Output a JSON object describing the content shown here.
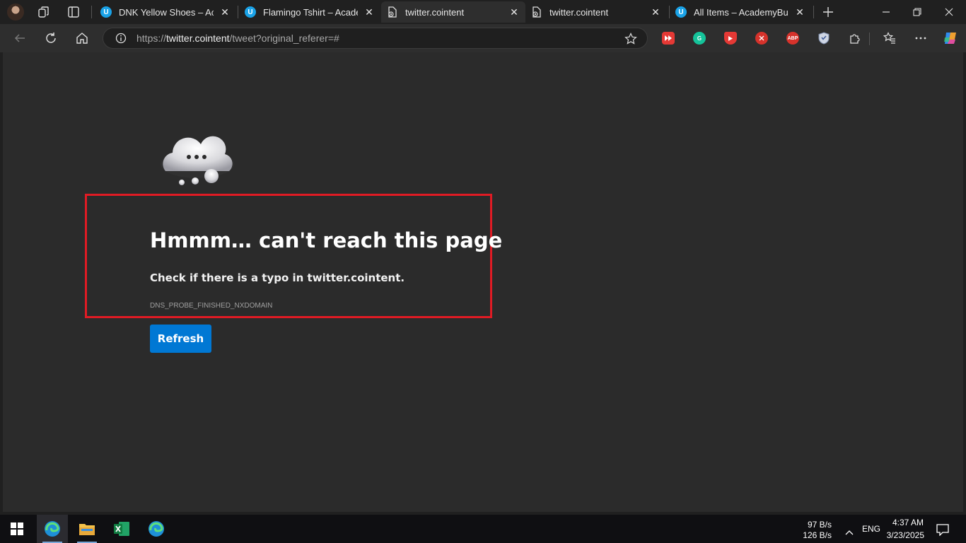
{
  "tabs": [
    {
      "title": "DNK Yellow Shoes – Academ",
      "favicon": "U",
      "active": false
    },
    {
      "title": "Flamingo Tshirt – Academy",
      "favicon": "U",
      "active": false
    },
    {
      "title": "twitter.cointent",
      "favicon": "",
      "active": true
    },
    {
      "title": "twitter.cointent",
      "favicon": "",
      "active": false
    },
    {
      "title": "All Items – AcademyBugs.c",
      "favicon": "U",
      "active": false
    }
  ],
  "address_bar": {
    "prefix": "https://",
    "host": "twitter.cointent",
    "path": "/tweet?original_referer=#"
  },
  "extensions": [
    {
      "name": "video-speed",
      "label": "",
      "color": "#e53935"
    },
    {
      "name": "grammarly",
      "label": "G",
      "color": "#15c39a"
    },
    {
      "name": "youtube-extension",
      "label": "",
      "color": "#e53935"
    },
    {
      "name": "ext-red-circle",
      "label": "",
      "color": "#d6322b"
    },
    {
      "name": "adblock-plus",
      "label": "ABP",
      "color": "#d6322b"
    },
    {
      "name": "shield-ext",
      "label": "",
      "color": "#7a8aa8"
    }
  ],
  "error_page": {
    "title": "Hmmm… can't reach this page",
    "subtitle": "Check if there is a typo in twitter.cointent.",
    "code": "DNS_PROBE_FINISHED_NXDOMAIN",
    "refresh_label": "Refresh"
  },
  "taskbar": {
    "net_down": "97 B/s",
    "net_up": "126 B/s",
    "language": "ENG",
    "time": "4:37 AM",
    "date": "3/23/2025"
  },
  "colors": {
    "accent": "#0078d4",
    "highlight_border": "#e01b24",
    "content_bg": "#2b2b2b"
  }
}
